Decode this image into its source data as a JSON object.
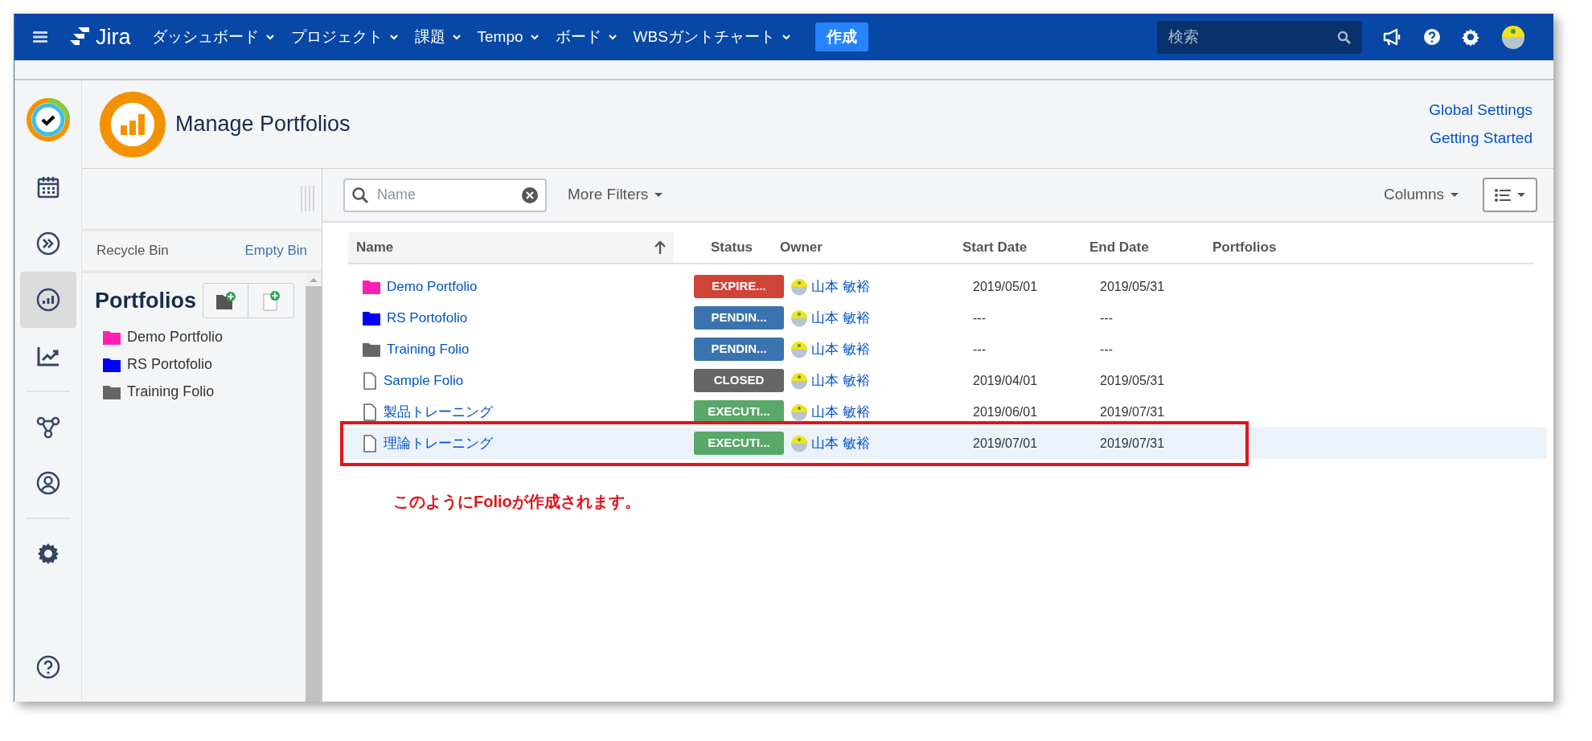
{
  "topbar": {
    "logo": "Jira",
    "nav": [
      {
        "label": "ダッシュボード"
      },
      {
        "label": "プロジェクト"
      },
      {
        "label": "課題"
      },
      {
        "label": "Tempo"
      },
      {
        "label": "ボード"
      },
      {
        "label": "WBSガントチャート"
      }
    ],
    "create": "作成",
    "search": {
      "placeholder": "検索"
    }
  },
  "rail": [
    {
      "items": [
        {
          "kind": "logo",
          "selected": false
        },
        {
          "kind": "calendar",
          "selected": false
        },
        {
          "kind": "forward",
          "selected": false
        },
        {
          "kind": "portfolio",
          "selected": true
        },
        {
          "kind": "trend",
          "selected": false
        }
      ]
    },
    {
      "items": [
        {
          "kind": "network",
          "selected": false
        },
        {
          "kind": "user",
          "selected": false
        }
      ]
    },
    {
      "items": [
        {
          "kind": "settings",
          "selected": false
        }
      ]
    },
    {
      "items": [
        {
          "kind": "help",
          "selected": false
        }
      ]
    }
  ],
  "header": {
    "title": "Manage Portfolios",
    "links": [
      "Global Settings",
      "Getting Started"
    ]
  },
  "sidebar": {
    "recycle_bin": "Recycle Bin",
    "empty_bin": "Empty Bin",
    "heading": "Portfolios",
    "tree": [
      {
        "name": "Demo Portfolio",
        "color": "#ff1fb4"
      },
      {
        "name": "RS Portofolio",
        "color": "#0000ff"
      },
      {
        "name": "Training Folio",
        "color": "#666666"
      }
    ]
  },
  "toolbar": {
    "search": {
      "placeholder": "Name"
    },
    "more_filters": "More Filters",
    "columns": "Columns"
  },
  "table": {
    "columns": [
      "Name",
      "Status",
      "Owner",
      "Start Date",
      "End Date",
      "Portfolios"
    ],
    "rows": [
      {
        "kind": "folder",
        "color": "#ff1fb4",
        "name": "Demo Portfolio",
        "status": {
          "text": "EXPIRE...",
          "color": "#d04437"
        },
        "owner": "山本 敏裕",
        "start": "2019/05/01",
        "end": "2019/05/31",
        "selected": false
      },
      {
        "kind": "folder",
        "color": "#0000ff",
        "name": "RS Portofolio",
        "status": {
          "text": "PENDIN...",
          "color": "#3b73af"
        },
        "owner": "山本 敏裕",
        "start": "---",
        "end": "---",
        "selected": false
      },
      {
        "kind": "folder",
        "color": "#666666",
        "name": "Training Folio",
        "status": {
          "text": "PENDIN...",
          "color": "#3b73af"
        },
        "owner": "山本 敏裕",
        "start": "---",
        "end": "---",
        "selected": false
      },
      {
        "kind": "file",
        "name": "Sample Folio",
        "status": {
          "text": "CLOSED",
          "color": "#666666"
        },
        "owner": "山本 敏裕",
        "start": "2019/04/01",
        "end": "2019/05/31",
        "selected": false
      },
      {
        "kind": "file",
        "name": "製品トレーニング",
        "status": {
          "text": "EXECUTI...",
          "color": "#59a869"
        },
        "owner": "山本 敏裕",
        "start": "2019/06/01",
        "end": "2019/07/31",
        "selected": false
      },
      {
        "kind": "file",
        "name": "理論トレーニング",
        "status": {
          "text": "EXECUTI...",
          "color": "#59a869"
        },
        "owner": "山本 敏裕",
        "start": "2019/07/01",
        "end": "2019/07/31",
        "selected": true
      }
    ]
  },
  "annotation": "このように**Folio**が作成されます。"
}
